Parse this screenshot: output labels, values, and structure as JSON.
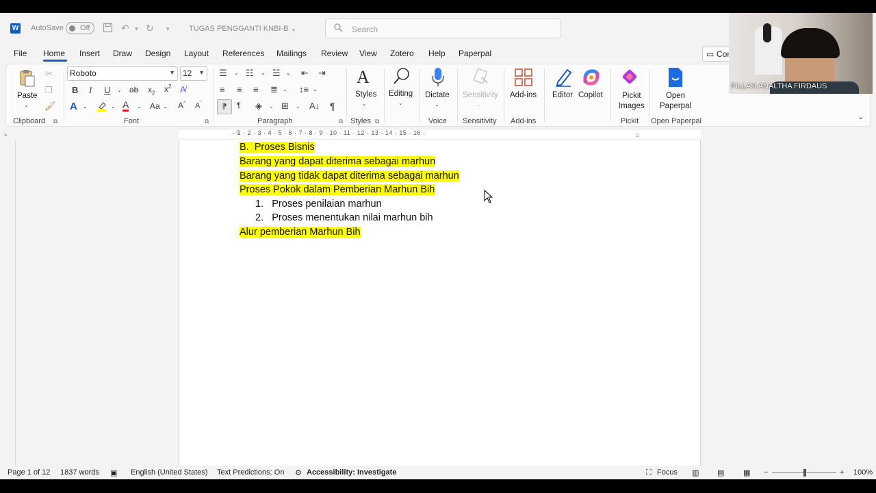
{
  "titlebar": {
    "autosave_label": "AutoSave",
    "autosave_state": "Off",
    "document_title": "TUGAS PENGGANTI KNBI-B",
    "search_placeholder": "Search"
  },
  "menu": {
    "tabs": [
      "File",
      "Home",
      "Insert",
      "Draw",
      "Design",
      "Layout",
      "References",
      "Mailings",
      "Review",
      "View",
      "Zotero",
      "Help",
      "Paperpal"
    ],
    "active_tab": "Home",
    "comments_label": "Com"
  },
  "ribbon": {
    "clipboard": {
      "paste_label": "Paste",
      "group_label": "Clipboard"
    },
    "font": {
      "font_name": "Roboto",
      "font_size": "12",
      "group_label": "Font"
    },
    "paragraph": {
      "group_label": "Paragraph"
    },
    "styles": {
      "label": "Styles",
      "group_label": "Styles"
    },
    "editing": {
      "label": "Editing"
    },
    "voice": {
      "dictate_label": "Dictate",
      "group_label": "Voice"
    },
    "sensitivity": {
      "label": "Sensitivity",
      "group_label": "Sensitivity"
    },
    "addins": {
      "label": "Add-ins",
      "group_label": "Add-ins"
    },
    "editor": {
      "label": "Editor"
    },
    "copilot": {
      "label": "Copilot"
    },
    "pickit": {
      "label_line1": "Pickit",
      "label_line2": "Images",
      "group_label": "Pickit"
    },
    "paperpal": {
      "label_line1": "Open",
      "label_line2": "Paperpal",
      "group_label": "Open Paperpal"
    }
  },
  "ruler": {
    "marks": "· 1 · 2 · 3 · 4 · 5 · 6 · 7 · 8 · 9 · 10 · 11 · 12 · 13 · 14 · 15 · 16 ·"
  },
  "document": {
    "heading_marker": "B.",
    "heading_text": "Proses Bisnis",
    "line1": "Barang yang dapat diterima sebagai marhun",
    "line2": "Barang yang tidak dapat diterima sebagai marhun",
    "line3": "Proses Pokok dalam Pemberian Marhun Bih",
    "list": [
      {
        "num": "1.",
        "text": "Proses penilaian marhun"
      },
      {
        "num": "2.",
        "text": "Proses menentukan nilai marhun bih"
      }
    ],
    "line4": "Alur pemberian Marhun Bih"
  },
  "statusbar": {
    "page": "Page 1 of 12",
    "words": "1837 words",
    "language": "English (United States)",
    "text_predictions": "Text Predictions: On",
    "accessibility": "Accessibility: Investigate",
    "focus": "Focus",
    "zoom": "100%"
  },
  "webcam": {
    "participant_name": "FILLAH ANALTHA FIRDAUS"
  },
  "colors": {
    "accent": "#185abd",
    "highlight": "#ffff00",
    "copilot": "#7b5cff"
  }
}
